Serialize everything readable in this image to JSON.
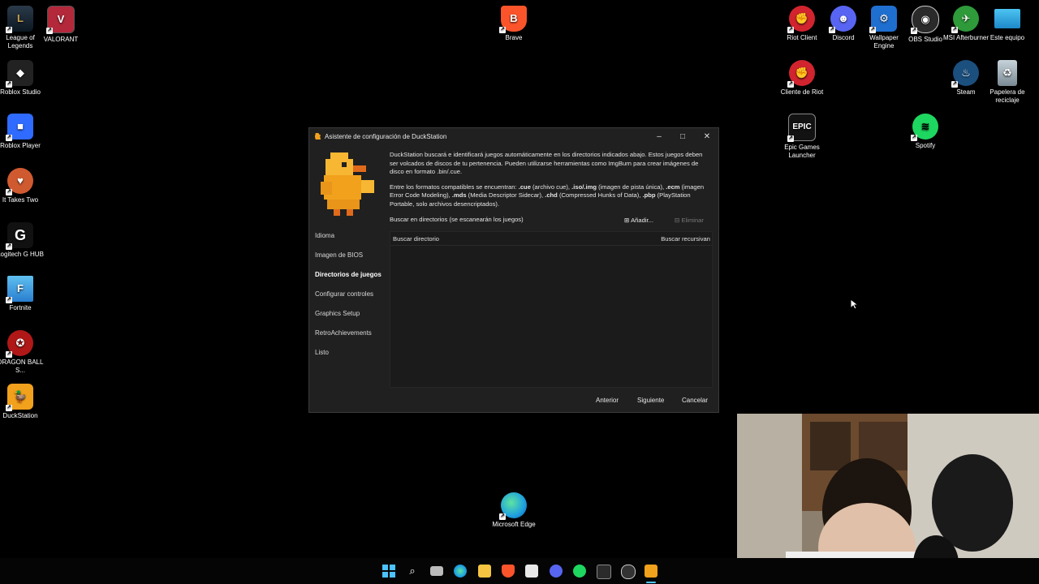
{
  "desktop_icons_left": [
    {
      "label": "League of Legends",
      "color": "#c8a24a"
    },
    {
      "label": "VALORANT",
      "color": "#b3283a"
    },
    {
      "label": "Roblox Studio",
      "color": "#222222"
    },
    {
      "label": "Roblox Player",
      "color": "#2f6bff"
    },
    {
      "label": "It Takes Two",
      "color": "#d05a30"
    },
    {
      "label": "Logitech G HUB",
      "color": "#111111"
    },
    {
      "label": "Fortnite",
      "color": "#3aa0e6"
    },
    {
      "label": "DRAGON BALL S...",
      "color": "#b01818"
    },
    {
      "label": "DuckStation",
      "color": "#f2a11c"
    }
  ],
  "desktop_icons_right": [
    {
      "label": "Riot Client",
      "color": "#d1242f"
    },
    {
      "label": "Discord",
      "color": "#5865f2"
    },
    {
      "label": "Wallpaper Engine",
      "color": "#1f6fd0"
    },
    {
      "label": "OBS Studio",
      "color": "#2a2a2a"
    },
    {
      "label": "MSI Afterburner",
      "color": "#2e9a3a"
    },
    {
      "label": "Este equipo",
      "color": "#2ea8e6"
    },
    {
      "label": "Cliente de Riot",
      "color": "#d1242f"
    },
    {
      "label": "Steam",
      "color": "#1b4f7e"
    },
    {
      "label": "Papelera de reciclaje",
      "color": "#7a8a94"
    },
    {
      "label": "Epic Games Launcher",
      "color": "#121212"
    },
    {
      "label": "Spotify",
      "color": "#1ed760"
    }
  ],
  "desktop_center": {
    "brave": {
      "label": "Brave",
      "color": "#fb542b"
    },
    "edge": {
      "label": "Microsoft Edge",
      "color": "#1ea0e0"
    }
  },
  "dialog": {
    "title": "Asistente de configuración de DuckStation",
    "nav": [
      "Idioma",
      "Imagen de BIOS",
      "Directorios de juegos",
      "Configurar controles",
      "Graphics Setup",
      "RetroAchievements",
      "Listo"
    ],
    "active_nav": "Directorios de juegos",
    "intro_text": "DuckStation buscará e identificará juegos automáticamente en los directorios indicados abajo. Estos juegos deben ser volcados de discos de tu pertenencia. Pueden utilizarse herramientas como ImgBurn para crear imágenes de disco en formato .bin/.cue.",
    "formats": {
      "prefix": "Entre los formatos compatibles se encuentran: ",
      "cue": ".cue",
      "cue_desc": " (archivo cue), ",
      "iso": ".iso/.img",
      "iso_desc": " (imagen de pista única), ",
      "ecm": ".ecm",
      "ecm_desc": " (imagen Error Code Modeling), ",
      "mds": ".mds",
      "mds_desc": " (Media Descriptor Sidecar), ",
      "chd": ".chd",
      "chd_desc": " (Compressed Hunks of Data), ",
      "pbp": ".pbp",
      "pbp_desc": " (PlayStation Portable, solo archivos desencriptados)."
    },
    "search_label": "Buscar en directorios (se escanearán los juegos)",
    "add_button": "Añadir...",
    "remove_button": "Eliminar",
    "col_directory": "Buscar directorio",
    "col_recursive": "Buscar recursivan",
    "btn_back": "Anterior",
    "btn_next": "Siguiente",
    "btn_cancel": "Cancelar"
  },
  "taskbar_icons": [
    "start",
    "search",
    "task-view",
    "edge",
    "file-explorer",
    "brave",
    "store",
    "discord",
    "spotify",
    "terminal",
    "obs",
    "duckstation"
  ],
  "colors": {
    "accent": "#2f8fd8",
    "dialog_bg": "#202020"
  }
}
